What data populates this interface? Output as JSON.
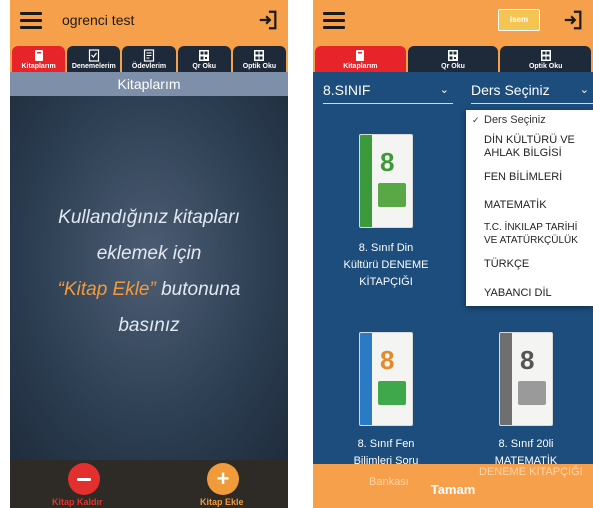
{
  "left": {
    "app_title": "ogrenci test",
    "tabs": [
      {
        "label": "Kitaplarım",
        "icon": "book-icon",
        "active": true
      },
      {
        "label": "Denemelerim",
        "icon": "exam-icon",
        "active": false
      },
      {
        "label": "Ödevlerim",
        "icon": "homework-icon",
        "active": false
      },
      {
        "label": "Qr Oku",
        "icon": "qr-code-icon",
        "active": false
      },
      {
        "label": "Optik Oku",
        "icon": "optic-form-icon",
        "active": false
      }
    ],
    "section_title": "Kitaplarım",
    "hero": {
      "line1": "Kullandığınız kitapları",
      "line2": "eklemek için",
      "line3_highlight": "“Kitap Ekle”",
      "line3_rest": " butonuna",
      "line4": "basınız"
    },
    "remove_label": "Kitap Kaldır",
    "add_label": "Kitap Ekle"
  },
  "right": {
    "logo_text": "isem",
    "tabs": [
      {
        "label": "Kitaplarım",
        "icon": "book-icon",
        "active": true
      },
      {
        "label": "Qr Oku",
        "icon": "qr-code-icon",
        "active": false
      },
      {
        "label": "Optik Oku",
        "icon": "optic-form-icon",
        "active": false
      }
    ],
    "class_select": "8.SINIF",
    "course_select": "Ders Seçiniz",
    "course_options": [
      "Ders Seçiniz",
      "DİN KÜLTÜRÜ VE",
      "AHLAK BİLGİSİ",
      "FEN BİLİMLERİ",
      "MATEMATİK",
      "T.C. İNKILAP TARİHİ",
      "VE ATATÜRKÇÜLÜK",
      "TÜRKÇE",
      "YABANCI DİL"
    ],
    "books": [
      {
        "title_l1": "8. Sınıf Din",
        "title_l2": "Kültürü DENEME",
        "title_l3": "KİTAPÇIĞI"
      },
      {
        "title_l1": "8. Sınıf Fen",
        "title_l2": "Bilimleri Soru",
        "title_l3": "Bankası"
      },
      {
        "title_l1": "8. Sınıf 20li",
        "title_l2": "MATEMATİK",
        "title_l3": "DENEME KİTAPÇIĞI"
      }
    ],
    "confirm_label": "Tamam",
    "colors": {
      "header": "#f7a04b",
      "active_tab": "#e8242b",
      "background": "#1d4d7c"
    }
  }
}
